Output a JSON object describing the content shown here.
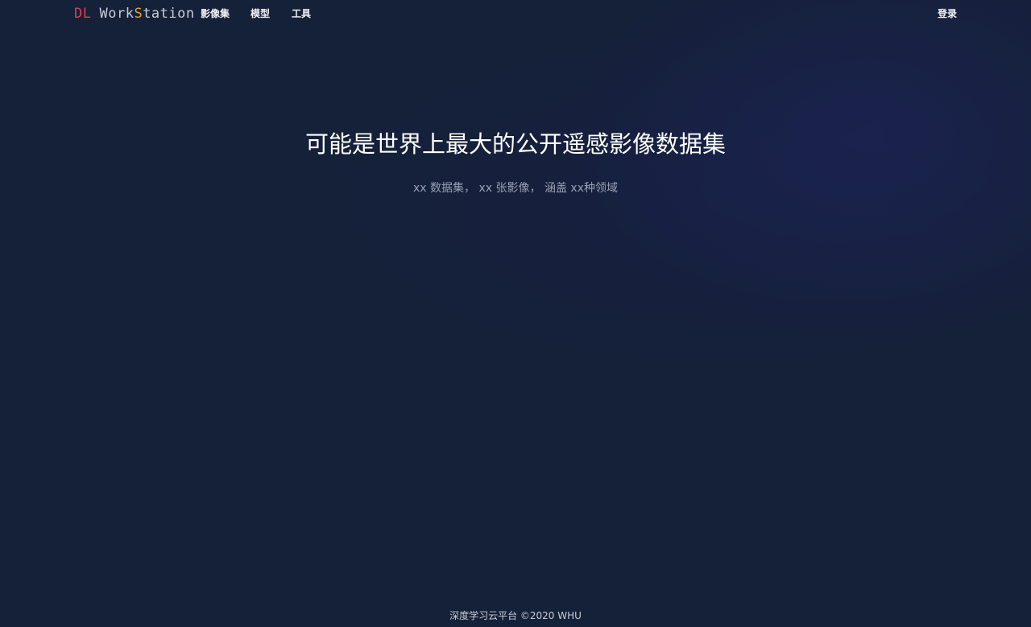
{
  "nav": {
    "logo_prefix": "DL",
    "logo_word_a": "Work",
    "logo_word_b": "S",
    "logo_word_c": "tation",
    "items": [
      {
        "label": "影像集"
      },
      {
        "label": "模型"
      },
      {
        "label": "工具"
      }
    ],
    "login_label": "登录"
  },
  "hero": {
    "title": "可能是世界上最大的公开遥感影像数据集",
    "subtitle": "xx 数据集， xx 张影像， 涵盖 xx种领域"
  },
  "footer": {
    "text": "深度学习云平台 ©2020 WHU"
  },
  "colors": {
    "background": "#152039",
    "logo_dl": "#d6405a",
    "logo_accent": "#e2a23a"
  }
}
